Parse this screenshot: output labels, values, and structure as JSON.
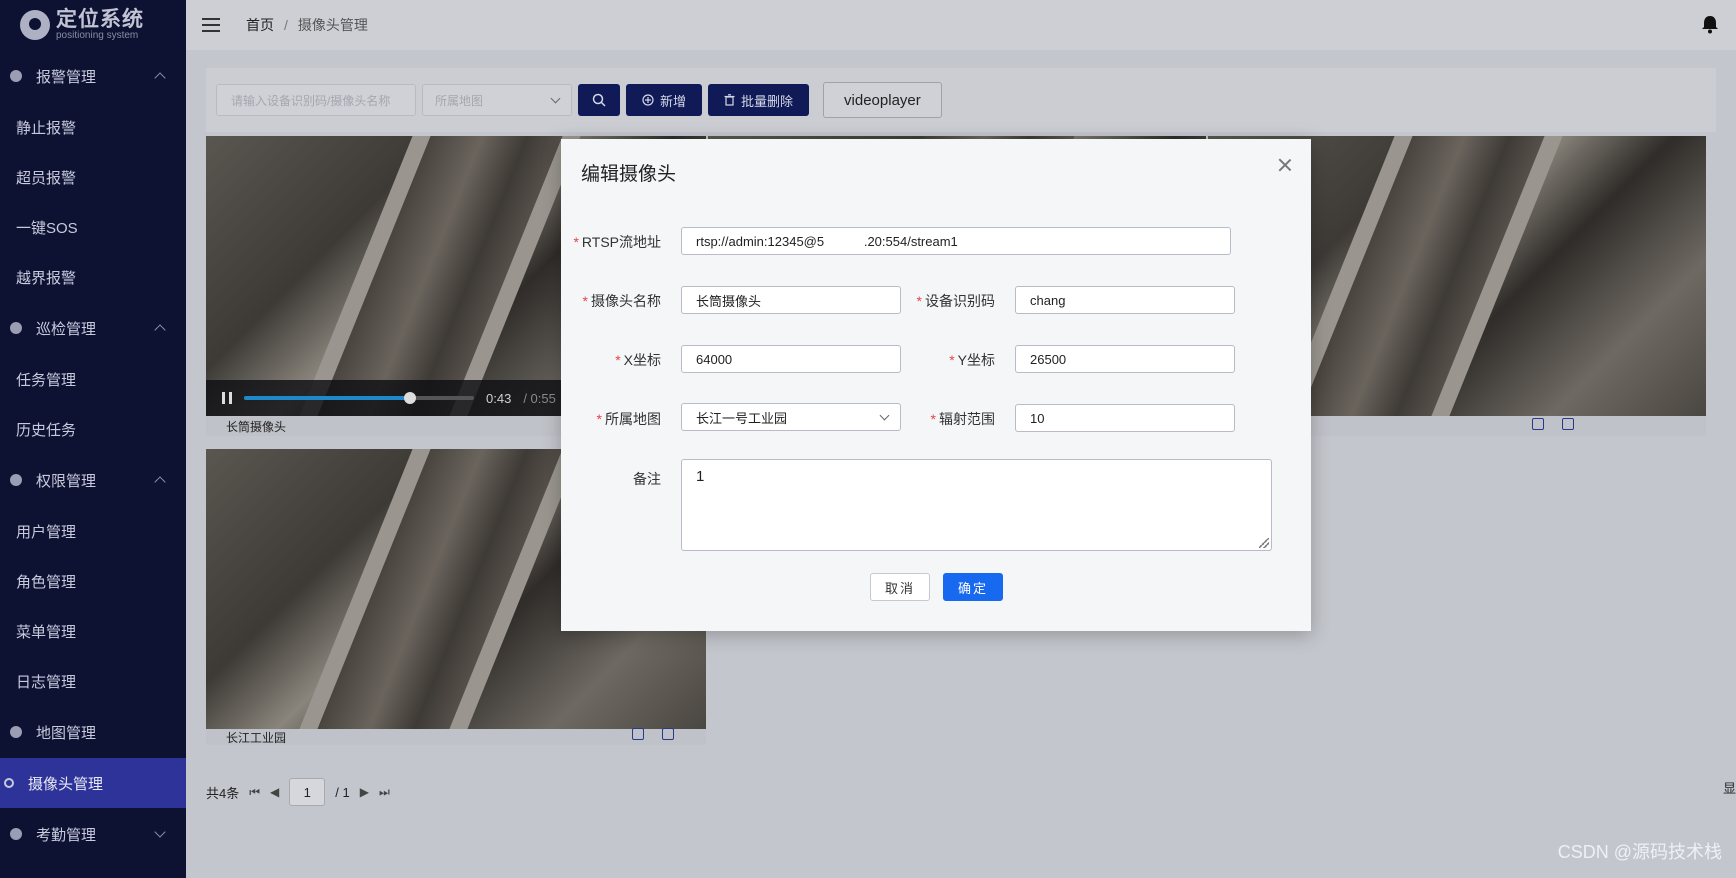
{
  "app": {
    "logo_title": "定位系统",
    "logo_subtitle": "positioning system"
  },
  "sidebar": {
    "groups": [
      {
        "label": "报警管理",
        "items": [
          "静止报警",
          "超员报警",
          "一键SOS",
          "越界报警"
        ]
      },
      {
        "label": "巡检管理",
        "items": [
          "任务管理",
          "历史任务"
        ]
      },
      {
        "label": "权限管理",
        "items": [
          "用户管理",
          "角色管理",
          "菜单管理",
          "日志管理"
        ]
      },
      {
        "label": "地图管理"
      },
      {
        "label": "摄像头管理",
        "active": true
      },
      {
        "label": "考勤管理"
      }
    ]
  },
  "header": {
    "breadcrumb_home": "首页",
    "breadcrumb_sep": "/",
    "breadcrumb_current": "摄像头管理"
  },
  "toolbar": {
    "search_placeholder": "请输入设备识别码/摄像头名称",
    "map_select_placeholder": "所属地图",
    "add_label": "新增",
    "batch_delete_label": "批量删除",
    "videoplayer_label": "videoplayer"
  },
  "cards": [
    {
      "label": "长筒摄像头",
      "time_current": "0:43",
      "time_total": "/ 0:55",
      "progress": 0.72
    },
    {
      "label": "长江工业园"
    }
  ],
  "pager": {
    "total": "共4条",
    "page": "1",
    "pages": "/ 1",
    "right_text": "显"
  },
  "watermark": "CSDN @源码技术栈",
  "modal": {
    "title": "编辑摄像头",
    "fields": {
      "rtsp_label": "RTSP流地址",
      "rtsp_value": "rtsp://admin:12345@5           .20:554/stream1",
      "name_label": "摄像头名称",
      "name_value": "长筒摄像头",
      "device_label": "设备识别码",
      "device_value": "chang",
      "x_label": "X坐标",
      "x_value": "64000",
      "y_label": "Y坐标",
      "y_value": "26500",
      "map_label": "所属地图",
      "map_value": "长江一号工业园",
      "range_label": "辐射范围",
      "range_value": "10",
      "remark_label": "备注",
      "remark_value": "1"
    },
    "cancel_label": "取消",
    "ok_label": "确定"
  }
}
